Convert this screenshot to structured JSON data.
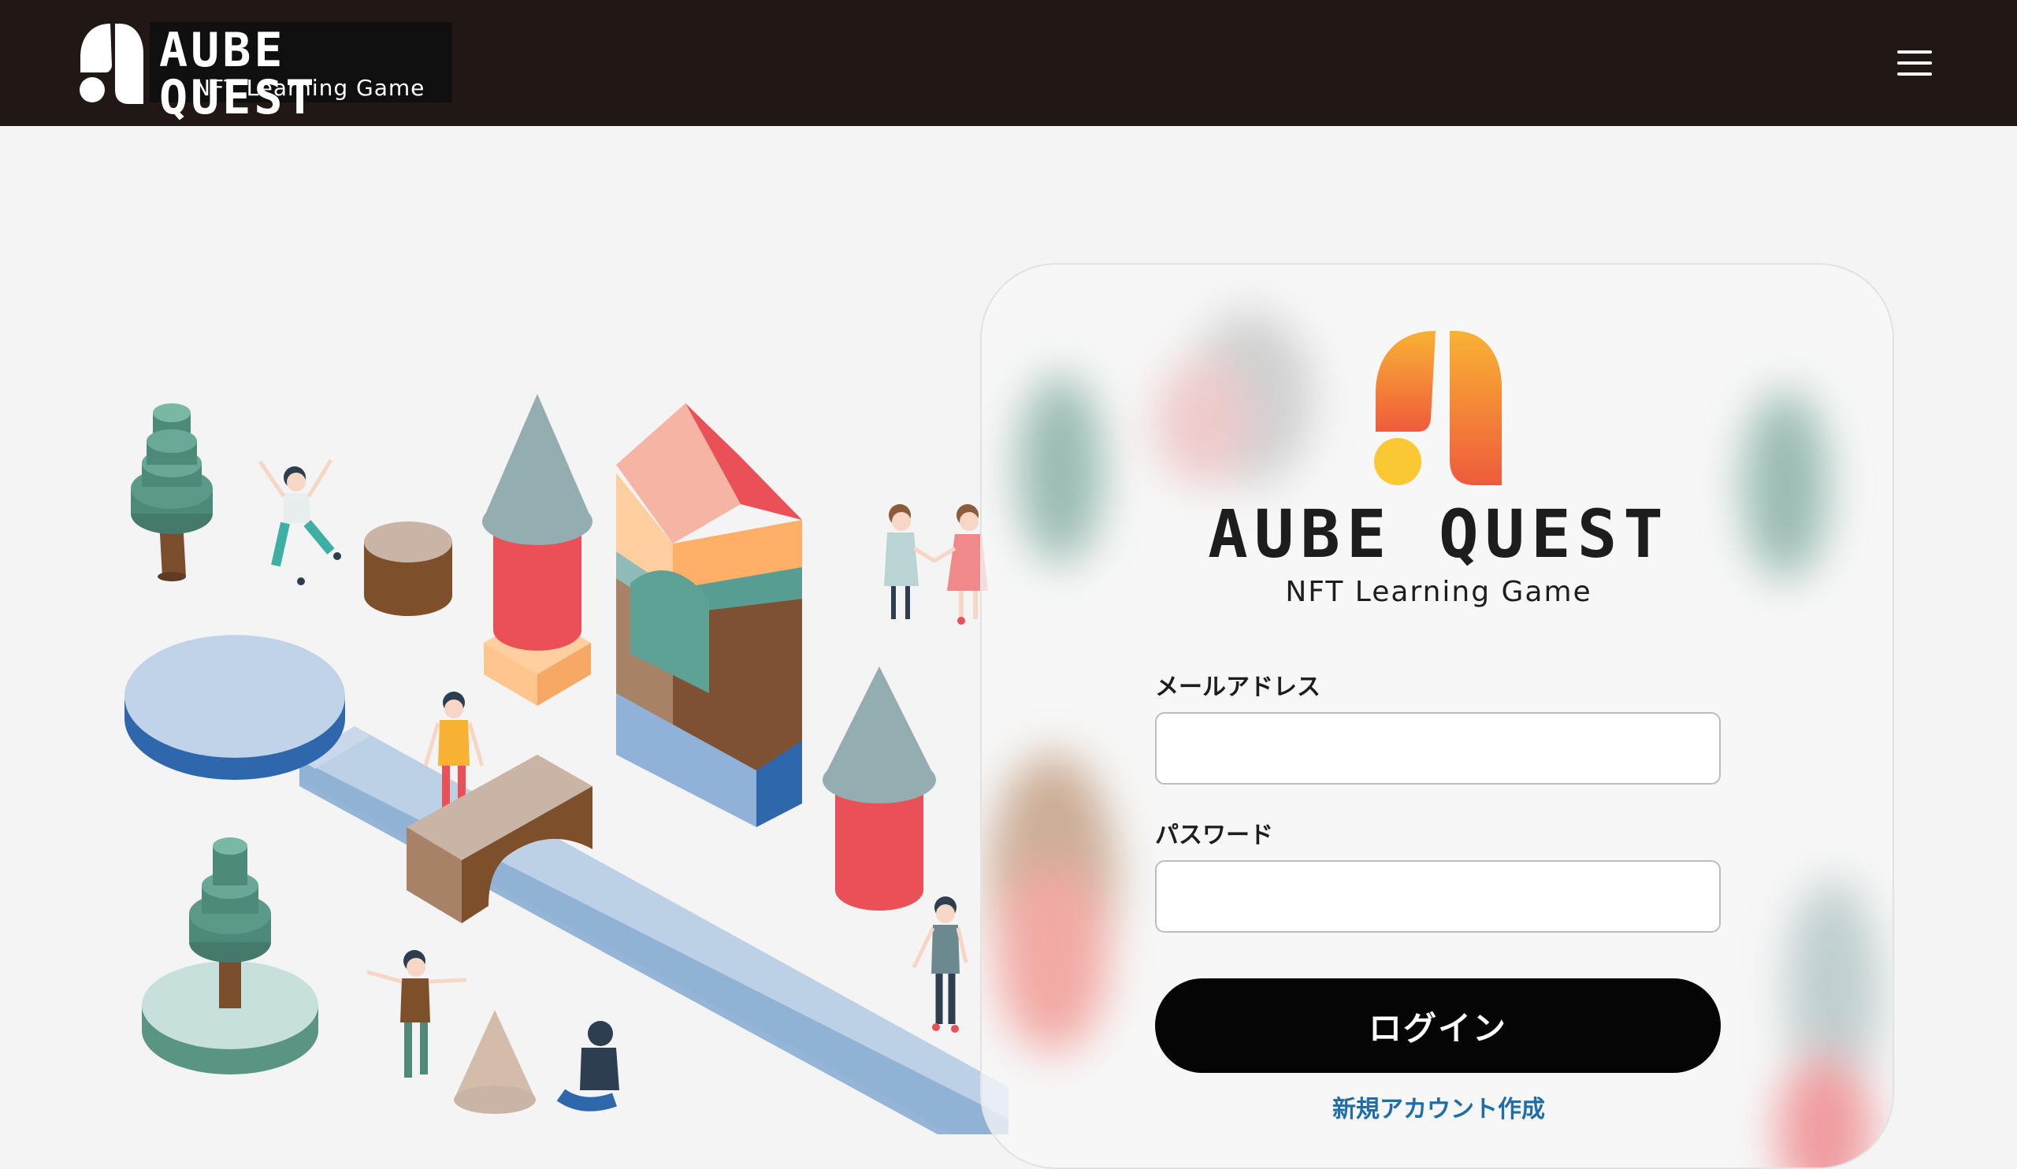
{
  "header": {
    "brand_title": "AUBE QUEST",
    "brand_subtitle": "NFT Learning Game",
    "menu_icon": "hamburger-menu-icon",
    "background_color": "#211816"
  },
  "login_card": {
    "logo_title": "AUBE QUEST",
    "logo_subtitle": "NFT Learning Game",
    "email_label": "メールアドレス",
    "email_value": "",
    "password_label": "パスワード",
    "password_value": "",
    "login_button": "ログイン",
    "signup_link": "新規アカウント作成"
  },
  "colors": {
    "accent_gradient_top": "#f9b233",
    "accent_gradient_bottom": "#ef5b3c",
    "accent_dot": "#f9c833",
    "link": "#1f6ea8",
    "button": "#050505"
  }
}
